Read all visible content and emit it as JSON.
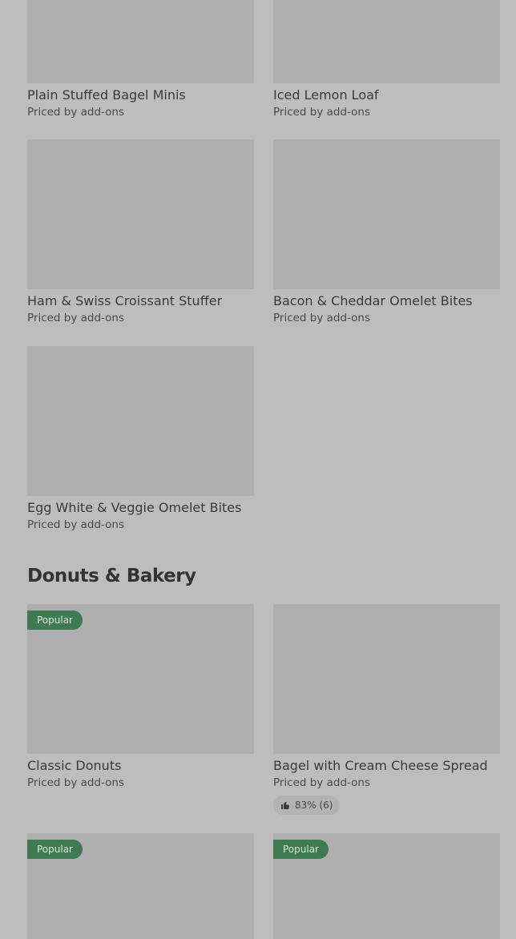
{
  "items_top": [
    {
      "title": "Plain Stuffed Bagel Minis",
      "subtitle": "Priced by add-ons"
    },
    {
      "title": "Iced Lemon Loaf",
      "subtitle": "Priced by add-ons"
    },
    {
      "title": "Ham & Swiss Croissant Stuffer",
      "subtitle": "Priced by add-ons"
    },
    {
      "title": "Bacon & Cheddar Omelet Bites",
      "subtitle": "Priced by add-ons"
    },
    {
      "title": "Egg White & Veggie Omelet Bites",
      "subtitle": "Priced by add-ons"
    }
  ],
  "section": {
    "title": "Donuts & Bakery"
  },
  "bakery_items": [
    {
      "badge": "Popular",
      "title": "Classic Donuts",
      "subtitle": "Priced by add-ons"
    },
    {
      "title": "Bagel with Cream Cheese Spread",
      "subtitle": "Priced by add-ons",
      "rating": "83% (6)",
      "rating_icon": "thumbs-up-icon"
    },
    {
      "badge": "Popular"
    },
    {
      "badge": "Popular"
    }
  ],
  "colors": {
    "background": "#bdbdbd",
    "image_placeholder": "#afafaf",
    "badge": "#3f7a52"
  }
}
